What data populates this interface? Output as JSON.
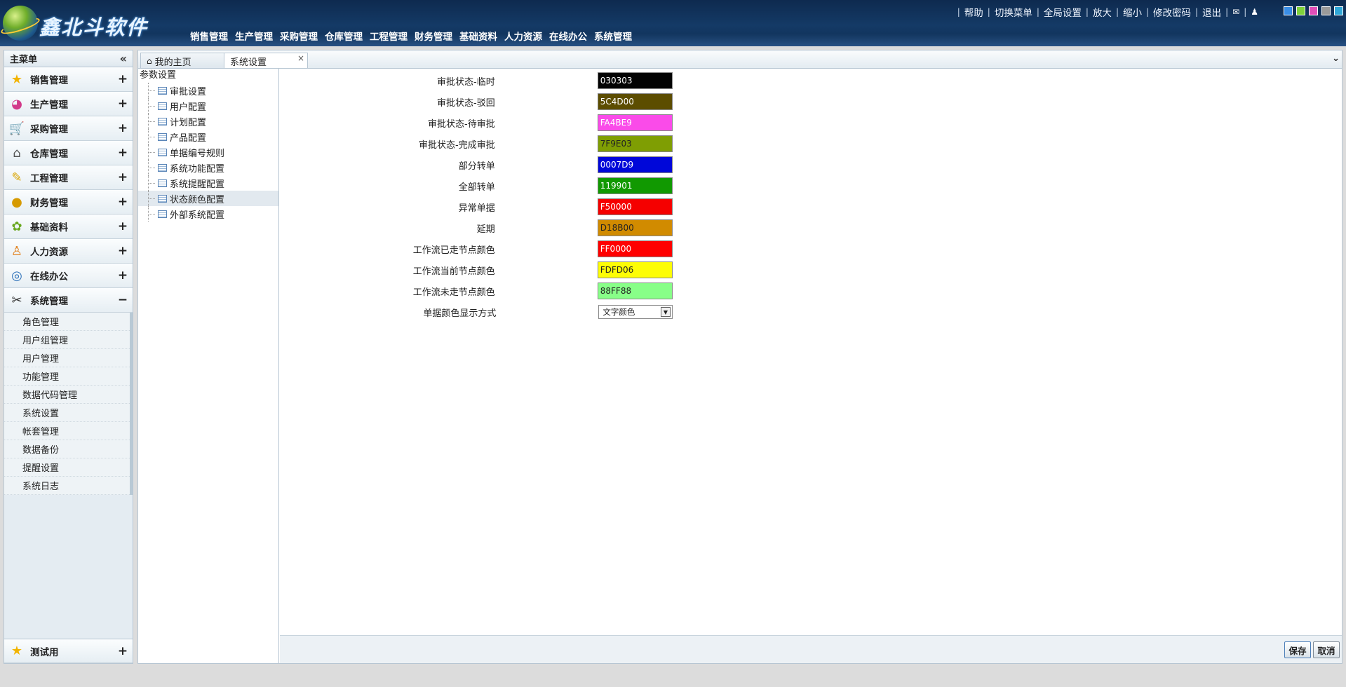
{
  "header": {
    "logo_text": "鑫北斗软件",
    "nav": [
      "销售管理",
      "生产管理",
      "采购管理",
      "仓库管理",
      "工程管理",
      "财务管理",
      "基础资料",
      "人力资源",
      "在线办公",
      "系统管理"
    ],
    "links": [
      "帮助",
      "切换菜单",
      "全局设置",
      "放大",
      "缩小",
      "修改密码",
      "退出"
    ],
    "skins": [
      "#3a8ee6",
      "#7fd13b",
      "#e04fb8",
      "#9a9a9a",
      "#2fa7d8"
    ]
  },
  "sidebar": {
    "title": "主菜单",
    "groups": [
      {
        "label": "销售管理",
        "icon": "star-icon",
        "toggle": "+"
      },
      {
        "label": "生产管理",
        "icon": "production-icon",
        "toggle": "+"
      },
      {
        "label": "采购管理",
        "icon": "cart-icon",
        "toggle": "+"
      },
      {
        "label": "仓库管理",
        "icon": "warehouse-icon",
        "toggle": "+"
      },
      {
        "label": "工程管理",
        "icon": "engineering-icon",
        "toggle": "+"
      },
      {
        "label": "财务管理",
        "icon": "coins-icon",
        "toggle": "+"
      },
      {
        "label": "基础资料",
        "icon": "basic-data-icon",
        "toggle": "+"
      },
      {
        "label": "人力资源",
        "icon": "people-icon",
        "toggle": "+"
      },
      {
        "label": "在线办公",
        "icon": "office-icon",
        "toggle": "+"
      },
      {
        "label": "系统管理",
        "icon": "system-tools-icon",
        "toggle": "−"
      }
    ],
    "subitems": [
      "角色管理",
      "用户组管理",
      "用户管理",
      "功能管理",
      "数据代码管理",
      "系统设置",
      "帐套管理",
      "数据备份",
      "提醒设置",
      "系统日志"
    ],
    "bottom_group": {
      "label": "测试用",
      "icon": "star-icon",
      "toggle": "+"
    }
  },
  "tabs": {
    "home": "我的主页",
    "active": "系统设置",
    "close": "×"
  },
  "tree": {
    "root": "参数设置",
    "nodes": [
      "审批设置",
      "用户配置",
      "计划配置",
      "产品配置",
      "单据编号规则",
      "系统功能配置",
      "系统提醒配置",
      "状态颜色配置",
      "外部系统配置"
    ],
    "active_index": 7
  },
  "form": {
    "rows": [
      {
        "label": "审批状态-临时",
        "value": "030303",
        "color": "#030303",
        "text_color": "#ffffff"
      },
      {
        "label": "审批状态-驳回",
        "value": "5C4D00",
        "color": "#5C4D00",
        "text_color": "#ffffff"
      },
      {
        "label": "审批状态-待审批",
        "value": "FA4BE9",
        "color": "#FA4BE9",
        "text_color": "#ffffff"
      },
      {
        "label": "审批状态-完成审批",
        "value": "7F9E03",
        "color": "#7F9E03",
        "text_color": "#222222"
      },
      {
        "label": "部分转单",
        "value": "0007D9",
        "color": "#0007D9",
        "text_color": "#ffffff"
      },
      {
        "label": "全部转单",
        "value": "119901",
        "color": "#119901",
        "text_color": "#ffffff"
      },
      {
        "label": "异常单据",
        "value": "F50000",
        "color": "#F50000",
        "text_color": "#ffffff"
      },
      {
        "label": "延期",
        "value": "D18B00",
        "color": "#D18B00",
        "text_color": "#222222"
      },
      {
        "label": "工作流已走节点颜色",
        "value": "FF0000",
        "color": "#FF0000",
        "text_color": "#ffffff"
      },
      {
        "label": "工作流当前节点颜色",
        "value": "FDFD06",
        "color": "#FDFD06",
        "text_color": "#222222"
      },
      {
        "label": "工作流未走节点颜色",
        "value": "88FF88",
        "color": "#88FF88",
        "text_color": "#222222"
      }
    ],
    "display_mode": {
      "label": "单据颜色显示方式",
      "value": "文字颜色"
    }
  },
  "actions": {
    "save": "保存",
    "cancel": "取消"
  }
}
